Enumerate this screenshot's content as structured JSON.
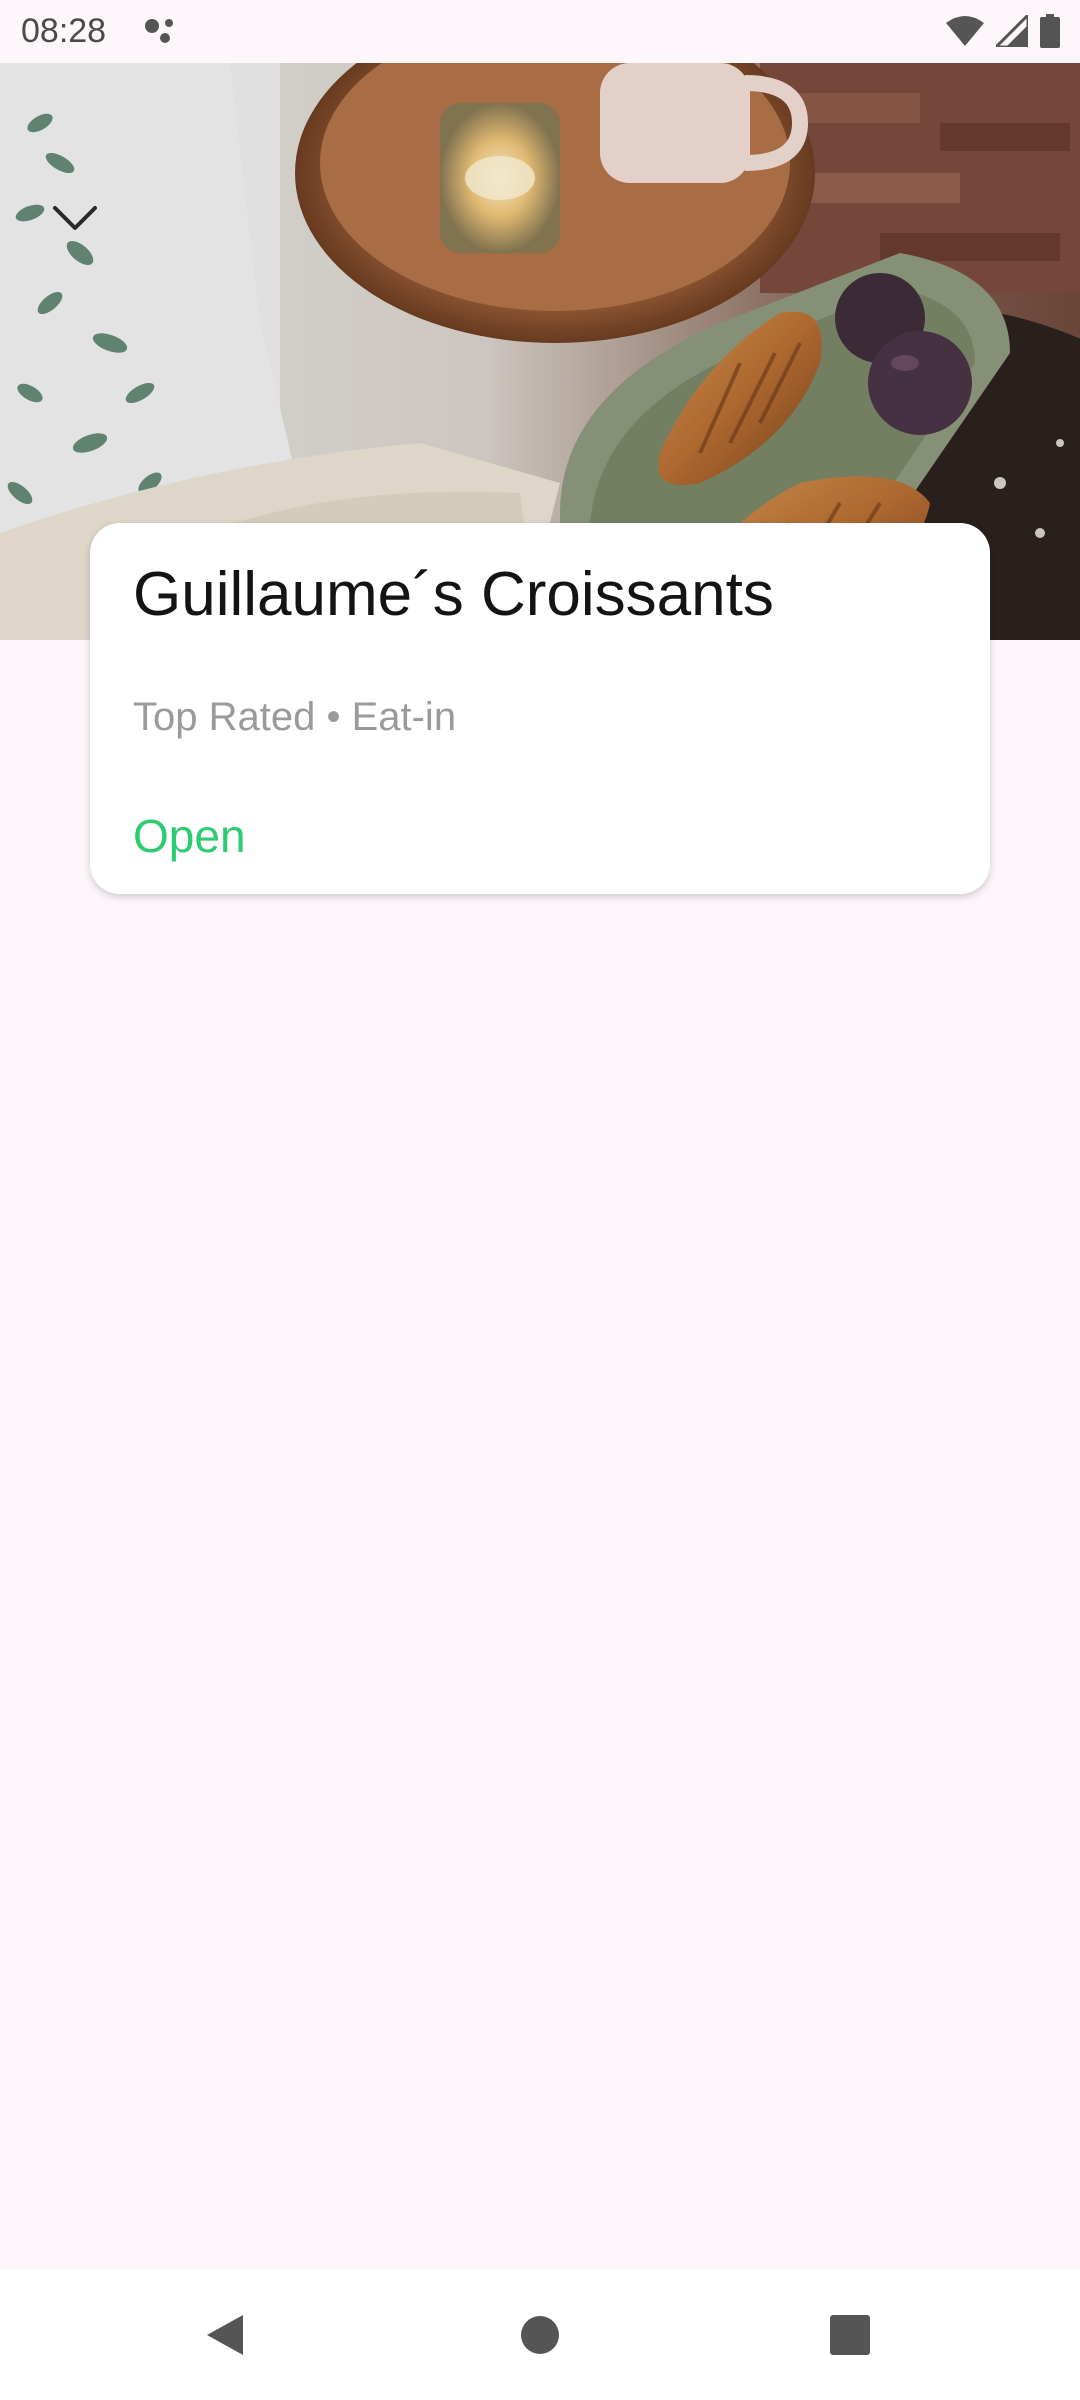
{
  "status_bar": {
    "time": "08:28",
    "icons": [
      "notification-dots-icon",
      "wifi-icon",
      "cell-signal-icon",
      "battery-icon"
    ]
  },
  "hero": {
    "image": "croissants-photo",
    "collapse_icon": "chevron-down-icon"
  },
  "card": {
    "title": "Guillaume´s Croissants",
    "subtitle": "Top Rated • Eat-in",
    "status": "Open",
    "status_color": "#2ecc71"
  },
  "nav_bar": {
    "icons": [
      "back-icon",
      "home-icon",
      "recents-icon"
    ]
  },
  "colors": {
    "background": "#fdf7fc",
    "card": "#ffffff",
    "open_green": "#2ecc71"
  }
}
